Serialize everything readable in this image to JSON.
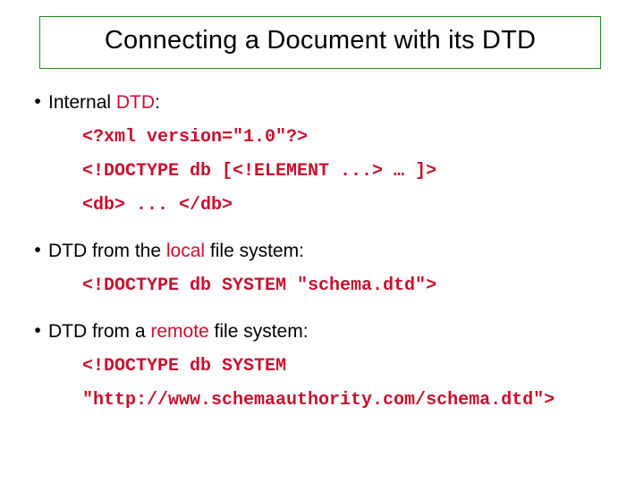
{
  "title": "Connecting a Document with its DTD",
  "bullets": {
    "b1_pre": "Internal ",
    "b1_red": "DTD",
    "b1_post": ":",
    "b2_pre": "DTD from the ",
    "b2_red": "local",
    "b2_post": " file system:",
    "b3_pre": "DTD from a ",
    "b3_red": "remote",
    "b3_post": " file system:"
  },
  "code": {
    "c1a": "<?xml version=\"1.0\"?>",
    "c1b": "<!DOCTYPE db [<!ELEMENT ...> … ]>",
    "c1c": "<db> ... </db>",
    "c2a": "<!DOCTYPE db SYSTEM \"schema.dtd\">",
    "c3a": "<!DOCTYPE db SYSTEM",
    "c3b": "\"http://www.schemaauthority.com/schema.dtd\">"
  },
  "glyphs": {
    "bullet": "•"
  }
}
